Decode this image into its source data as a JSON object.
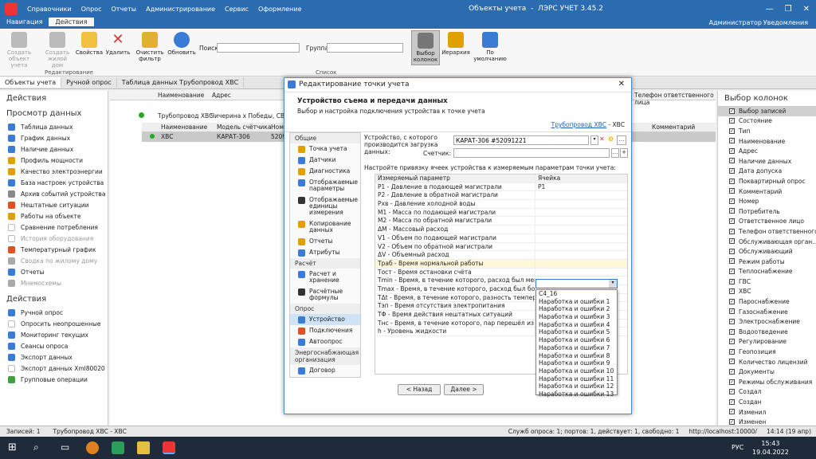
{
  "app": {
    "title": "Объекты учета",
    "subtitle": "ЛЭРС УЧЕТ 3.45.2",
    "user": "Администратор",
    "notifications": "Уведомления"
  },
  "menu": [
    "Справочники",
    "Опрос",
    "Отчеты",
    "Администрирование",
    "Сервис",
    "Оформление"
  ],
  "ribbon_tabs": [
    "Навигация",
    "Действия"
  ],
  "ribbon": {
    "create_object": "Создать объект учета",
    "create_house": "Создать жилой дом",
    "properties": "Свойства",
    "delete": "Удалить",
    "clear_filter": "Очистить фильтр",
    "refresh": "Обновить",
    "search_label": "Поиск:",
    "group_label": "Группа:",
    "choose_columns": "Выбор колонок",
    "hierarchy": "Иерархия",
    "default": "По умолчанию",
    "group_edit": "Редактирование",
    "group_list": "Список"
  },
  "doc_tabs": [
    "Объекты учета",
    "Ручной опрос",
    "Таблица данных Трубопровод ХВС"
  ],
  "left": {
    "actions_title": "Действия",
    "view_title": "Просмотр данных",
    "view_items": [
      {
        "label": "Таблица данных",
        "dis": false,
        "color": "#3a7bd5"
      },
      {
        "label": "График данных",
        "dis": false,
        "color": "#3a7bd5"
      },
      {
        "label": "Наличие данных",
        "dis": false,
        "color": "#3a7bd5"
      },
      {
        "label": "Профиль мощности",
        "dis": false,
        "color": "#e0a000"
      },
      {
        "label": "Качество электроэнергии",
        "dis": false,
        "color": "#e0a000"
      },
      {
        "label": "База настроек устройства",
        "dis": false,
        "color": "#3a7bd5"
      },
      {
        "label": "Архив событий устройства",
        "dis": false,
        "color": "#888"
      },
      {
        "label": "Нештатные ситуации",
        "dis": false,
        "color": "#e05020"
      },
      {
        "label": "Работы на объекте",
        "dis": false,
        "color": "#e0a000"
      },
      {
        "label": "Сравнение потребления",
        "dis": false,
        "color": "#fff"
      },
      {
        "label": "История оборудования",
        "dis": true,
        "color": "#fff"
      },
      {
        "label": "Температурный график",
        "dis": false,
        "color": "#e05020"
      },
      {
        "label": "Сводка по жилому дому",
        "dis": true,
        "color": "#aaa"
      },
      {
        "label": "Отчеты",
        "dis": false,
        "color": "#3a7bd5"
      },
      {
        "label": "Мнемосхемы",
        "dis": true,
        "color": "#aaa"
      }
    ],
    "actions2_title": "Действия",
    "action_items": [
      {
        "label": "Ручной опрос",
        "color": "#3a7bd5"
      },
      {
        "label": "Опросить неопрошенные",
        "color": "#fff"
      },
      {
        "label": "Мониторинг текущих",
        "color": "#3a7bd5"
      },
      {
        "label": "Сеансы опроса",
        "color": "#3a7bd5"
      },
      {
        "label": "Экспорт данных",
        "color": "#3a7bd5"
      },
      {
        "label": "Экспорт данных Xml80020",
        "color": "#fff"
      },
      {
        "label": "Групповые операции",
        "color": "#40a040"
      }
    ]
  },
  "grid": {
    "col_name": "Наименование",
    "col_address": "Адрес",
    "col_phone": "Телефон ответственного лица",
    "row1_name": "Трубопровод ХВС",
    "row1_address": "Чичерина х Победы, СВ угол",
    "sub_col_name": "Наименование",
    "sub_col_model": "Модель счётчика",
    "sub_col_num": "Номе",
    "sub_col_comment": "Комментарий",
    "sub_row_name": "ХВС",
    "sub_row_model": "КАРАТ-306",
    "sub_row_num": "52091"
  },
  "right": {
    "title": "Выбор колонок",
    "items": [
      {
        "label": "Выбор записей",
        "checked": true
      },
      {
        "label": "Состояние",
        "checked": true
      },
      {
        "label": "Тип",
        "checked": true
      },
      {
        "label": "Наименование",
        "checked": true
      },
      {
        "label": "Адрес",
        "checked": true
      },
      {
        "label": "Наличие данных",
        "checked": true
      },
      {
        "label": "Дата допуска",
        "checked": true
      },
      {
        "label": "Поквартирный опрос",
        "checked": true
      },
      {
        "label": "Комментарий",
        "checked": true
      },
      {
        "label": "Номер",
        "checked": true
      },
      {
        "label": "Потребитель",
        "checked": true
      },
      {
        "label": "Ответственное лицо",
        "checked": true
      },
      {
        "label": "Телефон ответственного",
        "checked": true
      },
      {
        "label": "Обслуживающая орган...",
        "checked": true
      },
      {
        "label": "Обслуживающий",
        "checked": true
      },
      {
        "label": "Режим работы",
        "checked": true
      },
      {
        "label": "Теплоснабжение",
        "checked": true
      },
      {
        "label": "ГВС",
        "checked": true
      },
      {
        "label": "ХВС",
        "checked": true
      },
      {
        "label": "Пароснабжение",
        "checked": true
      },
      {
        "label": "Газоснабжение",
        "checked": true
      },
      {
        "label": "Электроснабжение",
        "checked": true
      },
      {
        "label": "Водоотведение",
        "checked": true
      },
      {
        "label": "Регулирование",
        "checked": true
      },
      {
        "label": "Геопозиция",
        "checked": true
      },
      {
        "label": "Количество лицензий",
        "checked": true
      },
      {
        "label": "Документы",
        "checked": true
      },
      {
        "label": "Режимы обслуживания",
        "checked": true
      },
      {
        "label": "Создал",
        "checked": true
      },
      {
        "label": "Создан",
        "checked": true
      },
      {
        "label": "Изменил",
        "checked": true
      },
      {
        "label": "Изменен",
        "checked": true
      },
      {
        "label": "Формула (зима)",
        "checked": true
      }
    ]
  },
  "dialog": {
    "title": "Редактирование точки учета",
    "head": "Устройство съема и передачи данных",
    "subhead": "Выбор и настройка подключения устройства к точке учета",
    "link": "Трубопровод ХВС",
    "link_suffix": "- ХВС",
    "nav": [
      {
        "type": "h",
        "label": "Общие"
      },
      {
        "type": "i",
        "label": "Точка учета",
        "color": "#e0a000"
      },
      {
        "type": "i",
        "label": "Датчики",
        "color": "#3a7bd5"
      },
      {
        "type": "i",
        "label": "Диагностика",
        "color": "#e0a000"
      },
      {
        "type": "i",
        "label": "Отображаемые параметры",
        "color": "#3a7bd5"
      },
      {
        "type": "i",
        "label": "Отображаемые единицы измерения",
        "color": "#333"
      },
      {
        "type": "i",
        "label": "Копирование данных",
        "color": "#e0a000"
      },
      {
        "type": "i",
        "label": "Отчеты",
        "color": "#e0a000"
      },
      {
        "type": "i",
        "label": "Атрибуты",
        "color": "#3a7bd5"
      },
      {
        "type": "h",
        "label": "Расчёт"
      },
      {
        "type": "i",
        "label": "Расчет и хранение",
        "color": "#3a7bd5"
      },
      {
        "type": "i",
        "label": "Расчётные формулы",
        "color": "#333"
      },
      {
        "type": "h",
        "label": "Опрос"
      },
      {
        "type": "s",
        "label": "Устройство",
        "color": "#3a7bd5"
      },
      {
        "type": "i",
        "label": "Подключения",
        "color": "#e05020"
      },
      {
        "type": "i",
        "label": "Автоопрос",
        "color": "#3a7bd5"
      },
      {
        "type": "h",
        "label": "Энергоснабжающая организация"
      },
      {
        "type": "i",
        "label": "Договор",
        "color": "#3a7bd5"
      }
    ],
    "device_label": "Устройство, с которого производится загрузка данных:",
    "device_value": "КАРАТ-306 #52091221",
    "meter_label": "Счетчик:",
    "bind_label": "Настройте привязку ячеек устройства к измеряемым параметрам точки учета:",
    "col_param": "Измеряемый параметр",
    "col_cell": "Ячейка",
    "rows": [
      {
        "p": "P1 - Давление в подающей магистрали",
        "c": "P1"
      },
      {
        "p": "P2 - Давление в обратной магистрали",
        "c": ""
      },
      {
        "p": "Pхв - Давление холодной воды",
        "c": ""
      },
      {
        "p": "M1 - Масса по подающей магистрали",
        "c": ""
      },
      {
        "p": "M2 - Масса по обратной магистрали",
        "c": ""
      },
      {
        "p": "ΔM - Массовый расход",
        "c": ""
      },
      {
        "p": "V1 - Объем по подающей магистрали",
        "c": ""
      },
      {
        "p": "V2 - Объем по обратной магистрали",
        "c": ""
      },
      {
        "p": "ΔV - Объемный расход",
        "c": ""
      },
      {
        "p": "Траб - Время нормальной работы",
        "c": ""
      },
      {
        "p": "Тост - Время остановки счёта",
        "c": ""
      },
      {
        "p": "Tmin - Время, в течение которого, расход был меньше мини...",
        "c": ""
      },
      {
        "p": "Tmax - Время, в течение которого, расход был больше мак...",
        "c": ""
      },
      {
        "p": "TΔt - Время, в течение которого, разность температур был...",
        "c": ""
      },
      {
        "p": "Tэп - Время отсутствия электропитания",
        "c": ""
      },
      {
        "p": "TΦ - Время действия нештатных ситуаций",
        "c": ""
      },
      {
        "p": "Tнс - Время, в течение которого, пар перешёл из состояния...",
        "c": ""
      },
      {
        "p": "h - Уровень жидкости",
        "c": ""
      }
    ],
    "dropdown": [
      "C4_16",
      "Наработка и ошибки 1",
      "Наработка и ошибки 2",
      "Наработка и ошибки 3",
      "Наработка и ошибки 4",
      "Наработка и ошибки 5",
      "Наработка и ошибки 6",
      "Наработка и ошибки 7",
      "Наработка и ошибки 8",
      "Наработка и ошибки 9",
      "Наработка и ошибки 10",
      "Наработка и ошибки 11",
      "Наработка и ошибки 12",
      "Наработка и ошибки 13"
    ],
    "back": "< Назад",
    "next": "Далее >"
  },
  "status": {
    "records": "Записей: 1",
    "selected": "Трубопровод ХВС - ХВС",
    "service": "Служб опроса: 1; портов: 1, действует: 1, свободно: 1",
    "url": "http://localhost:10000/",
    "time": "14:14 (19 апр)"
  },
  "taskbar": {
    "time": "15:43",
    "date": "19.04.2022",
    "lang": "РУС"
  }
}
